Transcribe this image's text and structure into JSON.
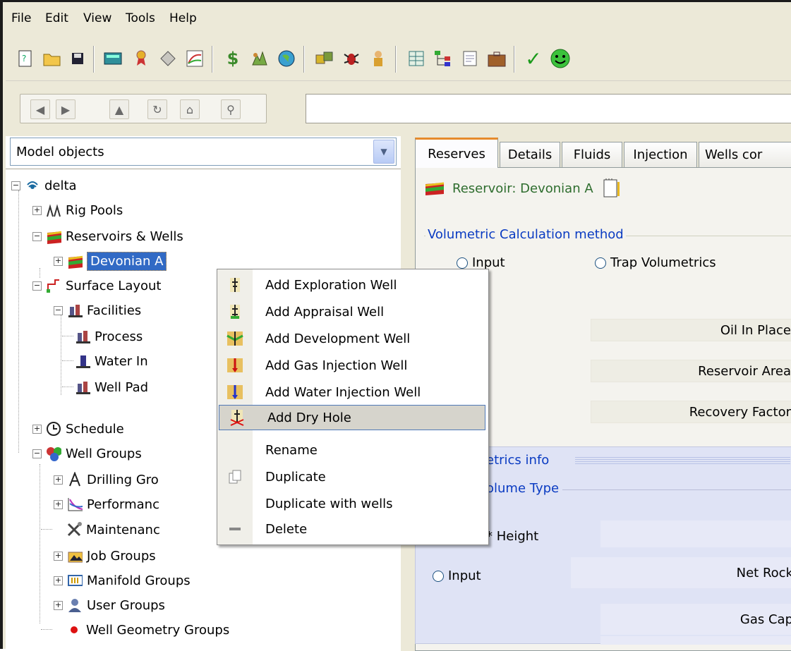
{
  "menubar": {
    "items": [
      "File",
      "Edit",
      "View",
      "Tools",
      "Help"
    ]
  },
  "left_panel": {
    "combo_label": "Model objects",
    "tree": {
      "root": "delta",
      "rig_pools": "Rig Pools",
      "reservoirs_wells": "Reservoirs & Wells",
      "devonian": "Devonian A",
      "surface_layout": "Surface Layout",
      "facilities": "Facilities",
      "process": "Process",
      "water_inj": "Water In",
      "well_pad": "Well Pad",
      "schedule": "Schedule",
      "well_groups": "Well Groups",
      "drilling_groups": "Drilling Gro",
      "performance": "Performanc",
      "maintenance": "Maintenanc",
      "job_groups": "Job Groups",
      "manifold_groups": "Manifold Groups",
      "user_groups": "User Groups",
      "well_geometry_groups": "Well Geometry Groups"
    }
  },
  "context_menu": {
    "items": [
      {
        "label": "Add Exploration Well",
        "icon": "exploration-well-icon"
      },
      {
        "label": "Add Appraisal Well",
        "icon": "appraisal-well-icon"
      },
      {
        "label": "Add Development Well",
        "icon": "development-well-icon"
      },
      {
        "label": "Add Gas Injection Well",
        "icon": "gas-injection-well-icon"
      },
      {
        "label": "Add Water Injection Well",
        "icon": "water-injection-well-icon"
      },
      {
        "label": "Add Dry Hole",
        "icon": "dry-hole-icon"
      },
      {
        "label": "Rename",
        "icon": ""
      },
      {
        "label": "Duplicate",
        "icon": "duplicate-icon"
      },
      {
        "label": "Duplicate with wells",
        "icon": ""
      },
      {
        "label": "Delete",
        "icon": "delete-icon"
      }
    ],
    "highlighted_index": 5
  },
  "right_panel": {
    "tabs": [
      "Reserves",
      "Details",
      "Fluids",
      "Injection",
      "Wells cor"
    ],
    "active_tab": "Reserves",
    "title": "Reservoir: Devonian A",
    "vol_method_label": "Volumetric Calculation method",
    "radio_input": "Input",
    "radio_trap": "Trap Volumetrics",
    "oil_in_place": "Oil In Place",
    "reservoir_area": "Reservoir Area",
    "recovery_factor": "Recovery Factor",
    "metrics_info": "etrics info",
    "volume_type": "olume Type",
    "height_label": "* Height",
    "input_label": "Input",
    "net_rock": "Net Rock",
    "gas_cap": "Gas Cap"
  },
  "colors": {
    "selection": "#316ac5",
    "title_green": "#2e6d2e",
    "group_blue": "#0a3bc2",
    "tab_accent": "#e68b2c"
  }
}
